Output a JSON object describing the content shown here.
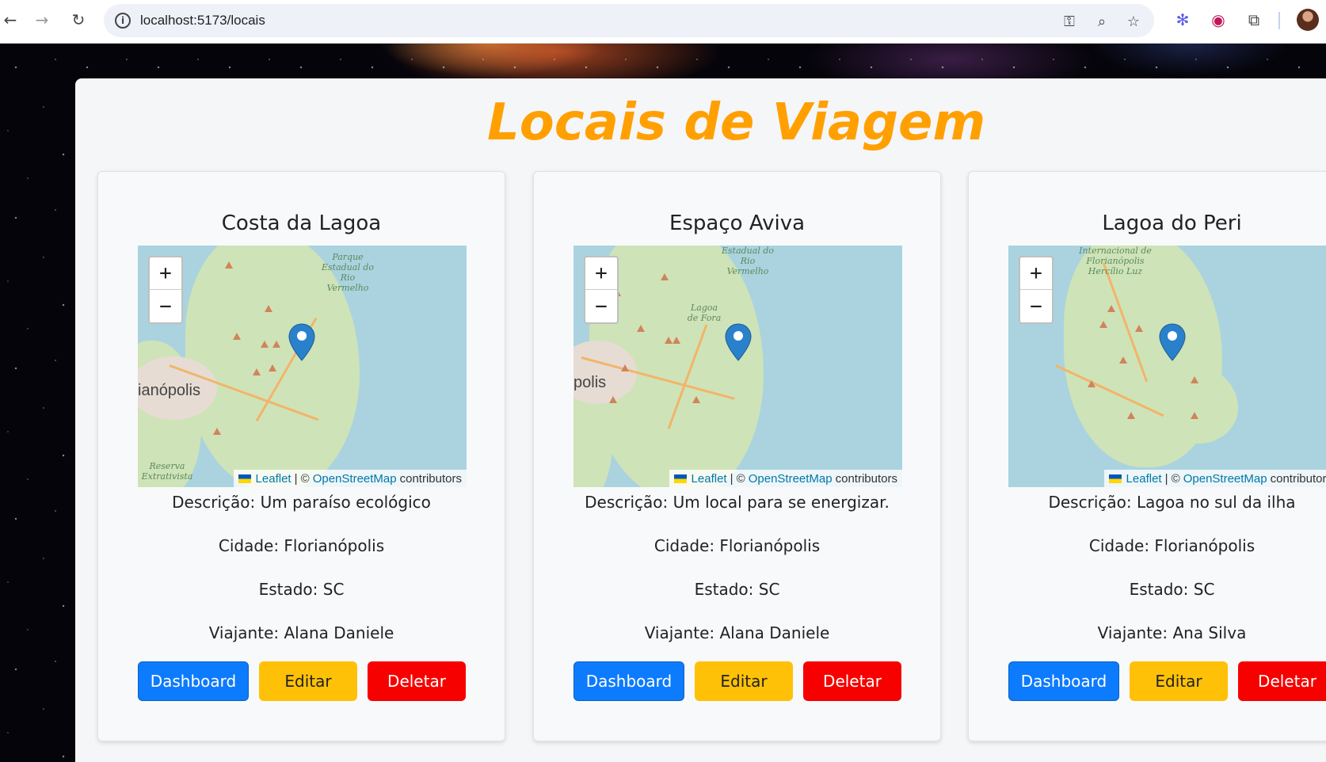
{
  "browser": {
    "url": "localhost:5173/locais"
  },
  "page": {
    "title": "Locais de Viagem"
  },
  "map": {
    "zoom_in": "+",
    "zoom_out": "−",
    "attrib_leaflet": "Leaflet",
    "attrib_sep": "| ©",
    "attrib_osm": "OpenStreetMap",
    "attrib_contrib": "contributors"
  },
  "cards": [
    {
      "title": "Costa da Lagoa",
      "descricao": "Descrição: Um paraíso ecológico",
      "cidade": "Cidade: Florianópolis",
      "estado": "Estado: SC",
      "viajante": "Viajante: Alana Daniele",
      "map_place": "ianópolis",
      "map_labels": [
        "Parque Estadual do Rio Vermelho",
        "Reserva Extrativista"
      ],
      "btn_dashboard": "Dashboard",
      "btn_editar": "Editar",
      "btn_deletar": "Deletar"
    },
    {
      "title": "Espaço Aviva",
      "descricao": "Descrição: Um local para se energizar.",
      "cidade": "Cidade: Florianópolis",
      "estado": "Estado: SC",
      "viajante": "Viajante: Alana Daniele",
      "map_place": "polis",
      "map_labels": [
        "Estadual do Rio Vermelho",
        "Lagoa de Fora"
      ],
      "btn_dashboard": "Dashboard",
      "btn_editar": "Editar",
      "btn_deletar": "Deletar"
    },
    {
      "title": "Lagoa do Peri",
      "descricao": "Descrição: Lagoa no sul da ilha",
      "cidade": "Cidade: Florianópolis",
      "estado": "Estado: SC",
      "viajante": "Viajante: Ana Silva",
      "map_place": "",
      "map_labels": [
        "Internacional de Florianópolis Hercílio Luz"
      ],
      "btn_dashboard": "Dashboard",
      "btn_editar": "Editar",
      "btn_deletar": "Deletar"
    }
  ]
}
